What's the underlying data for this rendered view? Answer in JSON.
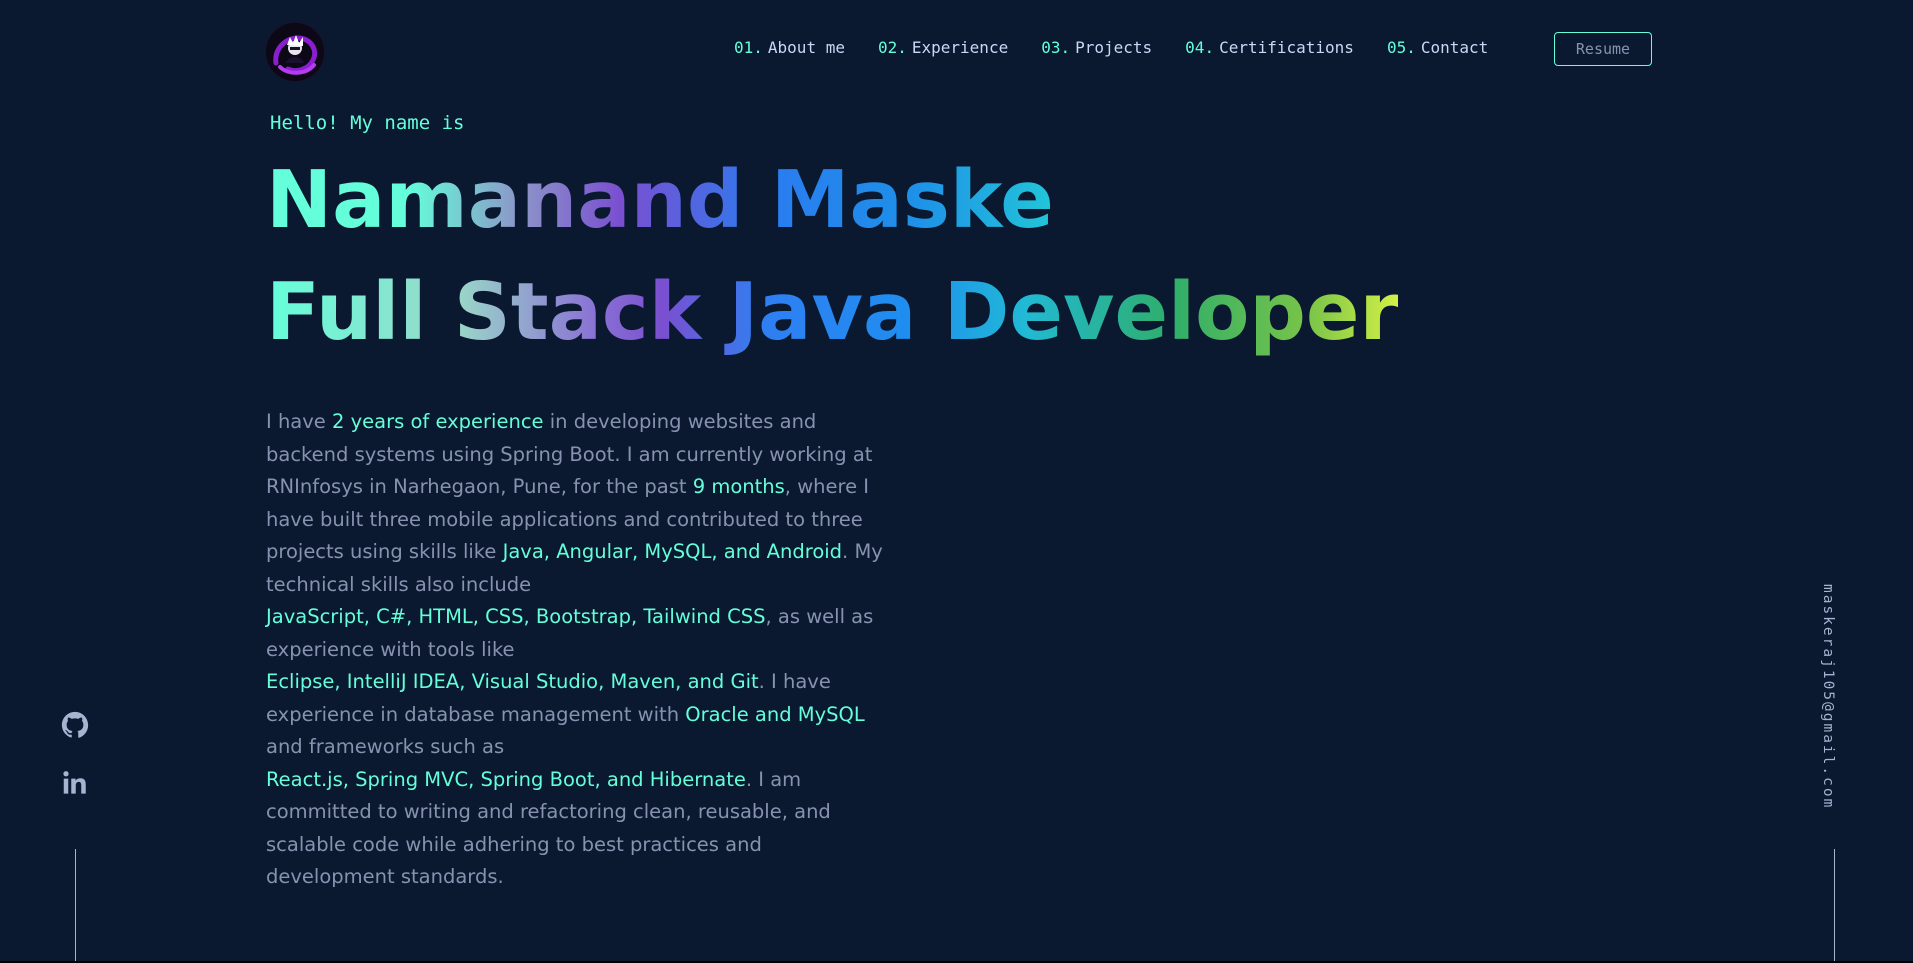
{
  "colors": {
    "background": "#0a192f",
    "accent": "#64ffda",
    "text_muted": "#8892b0",
    "text_light": "#ccd6f6"
  },
  "header": {
    "logo_icon": "avatar-logo-icon",
    "nav": [
      {
        "num": "01.",
        "label": "About me"
      },
      {
        "num": "02.",
        "label": "Experience"
      },
      {
        "num": "03.",
        "label": "Projects"
      },
      {
        "num": "04.",
        "label": "Certifications"
      },
      {
        "num": "05.",
        "label": "Contact"
      }
    ],
    "resume_label": "Resume"
  },
  "hero": {
    "greeting": "Hello! My name is",
    "name": "Namanand Maske",
    "role": "Full Stack Java Developer"
  },
  "bio": {
    "p1": "I have ",
    "h1": "2 years of experience",
    "p2": " in developing websites and backend systems using Spring Boot. I am currently working at RNInfosys in Narhegaon, Pune, for the past ",
    "h2": "9 months",
    "p3": ", where I have built three mobile applications and contributed to three projects using skills like ",
    "h3": "Java, Angular, MySQL, and Android",
    "p4": ". My technical skills also include",
    "h4": "JavaScript, C#, HTML, CSS, Bootstrap, Tailwind CSS",
    "p5": ", as well as experience with tools like",
    "h5": "Eclipse, IntelliJ IDEA, Visual Studio, Maven, and Git",
    "p6": ". I have experience in database management with ",
    "h6": "Oracle and MySQL",
    "p7": " and frameworks such as",
    "h7": "React.js, Spring MVC, Spring Boot, and Hibernate",
    "p8": ". I am committed to writing and refactoring clean, reusable, and scalable code while adhering to best practices and development standards."
  },
  "social": {
    "icons": [
      "github-icon",
      "linkedin-icon"
    ]
  },
  "email": "maskeraj105@gmail.com"
}
